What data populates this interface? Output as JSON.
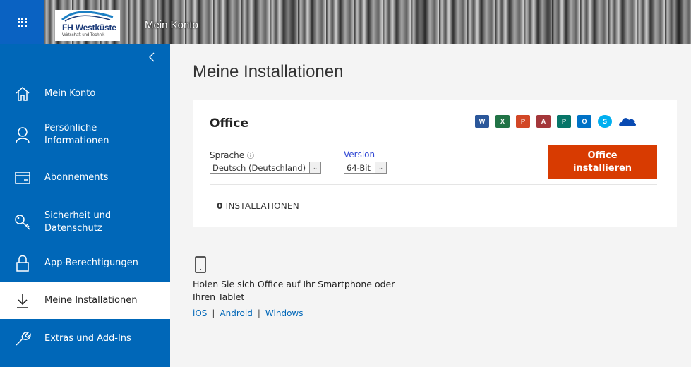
{
  "header": {
    "app_title": "Mein Konto",
    "logo_name": "FH Westküste",
    "logo_sub": "Wirtschaft und Technik"
  },
  "sidebar": {
    "items": [
      {
        "label": "Mein Konto",
        "icon": "home-icon"
      },
      {
        "label": "Persönliche Informationen",
        "icon": "person-icon"
      },
      {
        "label": "Abonnements",
        "icon": "card-icon"
      },
      {
        "label": "Sicherheit und Datenschutz",
        "icon": "key-icon"
      },
      {
        "label": "App-Berechtigungen",
        "icon": "lock-icon"
      },
      {
        "label": "Meine Installationen",
        "icon": "download-icon",
        "active": true
      },
      {
        "label": "Extras und Add-Ins",
        "icon": "wrench-icon"
      }
    ]
  },
  "main": {
    "title": "Meine Installationen",
    "office_card": {
      "title": "Office",
      "language_label": "Sprache",
      "language_value": "Deutsch (Deutschland)",
      "version_label": "Version",
      "version_value": "64-Bit",
      "install_button_line1": "Office",
      "install_button_line2": "installieren",
      "install_count_number": "0",
      "install_count_label": "INSTALLATIONEN",
      "apps": [
        {
          "letter": "W",
          "name": "word-icon",
          "color": "#2b579a"
        },
        {
          "letter": "X",
          "name": "excel-icon",
          "color": "#217346"
        },
        {
          "letter": "P",
          "name": "powerpoint-icon",
          "color": "#d24726"
        },
        {
          "letter": "A",
          "name": "access-icon",
          "color": "#a4373a"
        },
        {
          "letter": "P",
          "name": "publisher-icon",
          "color": "#077568"
        },
        {
          "letter": "O",
          "name": "outlook-icon",
          "color": "#0072c6"
        },
        {
          "letter": "S",
          "name": "skype-icon",
          "color": "#00aff0"
        },
        {
          "letter": "",
          "name": "onedrive-icon",
          "color": "#094ab2"
        }
      ]
    },
    "mobile": {
      "text": "Holen Sie sich Office auf Ihr Smartphone oder Ihren Tablet",
      "links": [
        "iOS",
        "Android",
        "Windows"
      ]
    }
  },
  "colors": {
    "sidebar": "#0067b8",
    "install_button": "#d83b01",
    "link": "#0067b8"
  }
}
